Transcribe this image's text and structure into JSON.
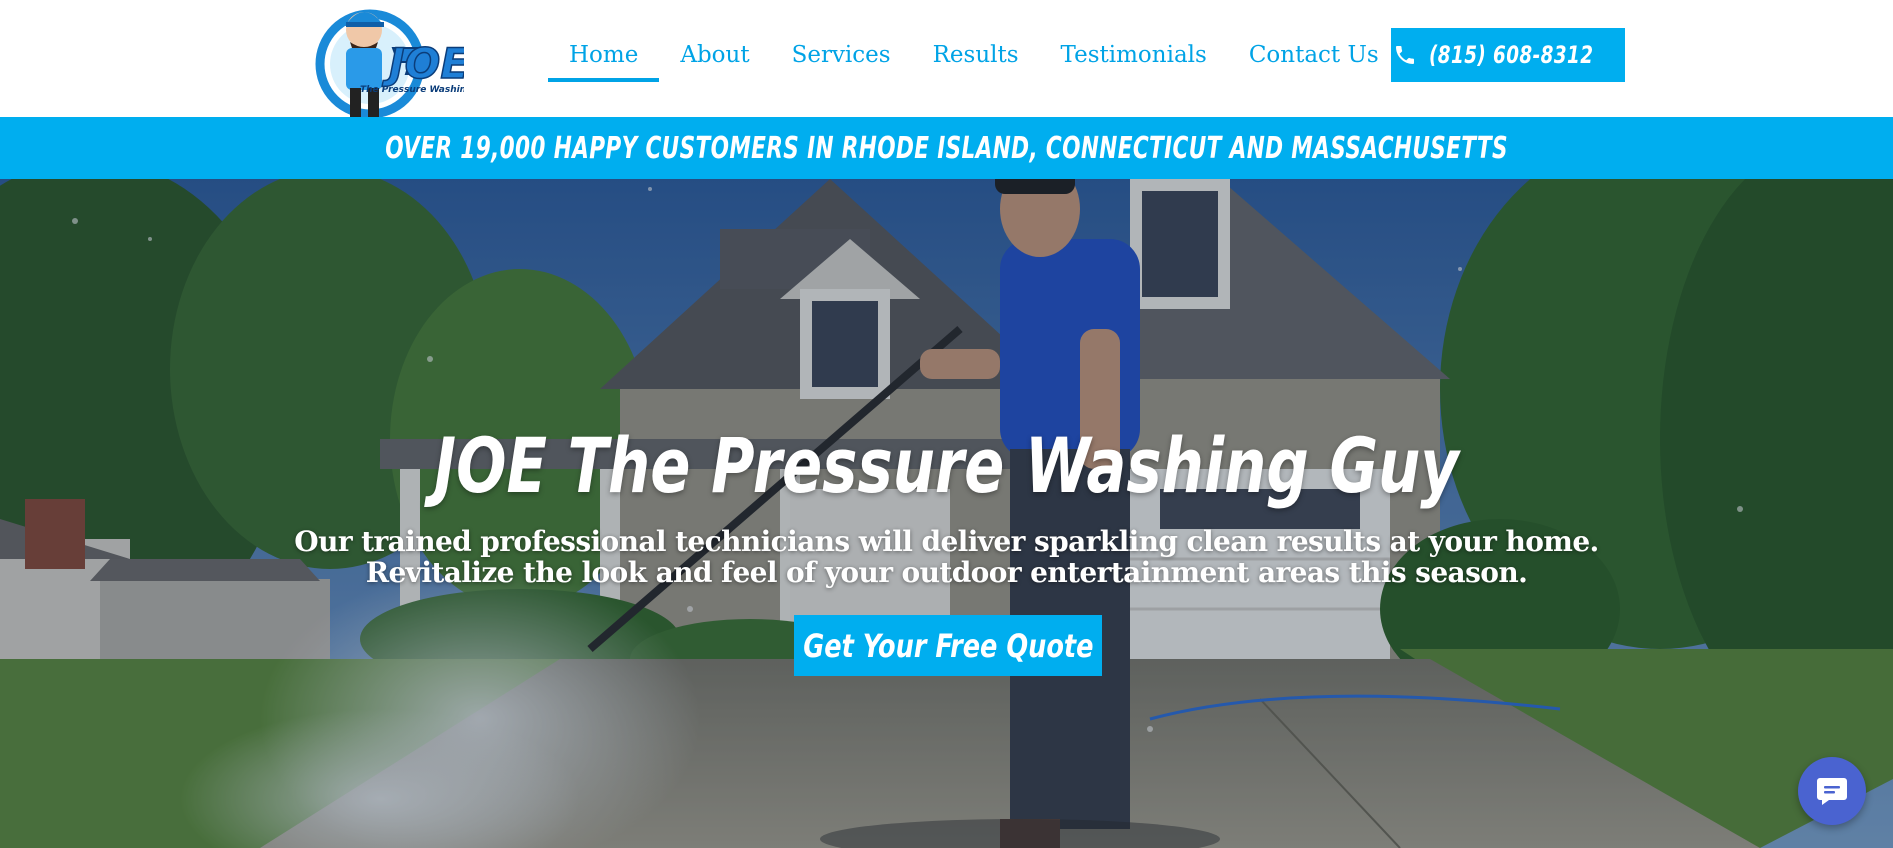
{
  "logo": {
    "name": "JOE",
    "tagline": "The Pressure Washing Guy",
    "alt": "JOE The Pressure Washing Guy logo"
  },
  "nav": {
    "items": [
      {
        "label": "Home",
        "active": true
      },
      {
        "label": "About",
        "active": false
      },
      {
        "label": "Services",
        "active": false
      },
      {
        "label": "Results",
        "active": false
      },
      {
        "label": "Testimonials",
        "active": false
      },
      {
        "label": "Contact Us",
        "active": false
      }
    ]
  },
  "header": {
    "phone": "(815) 608-8312",
    "phone_icon": "phone-icon"
  },
  "banner": {
    "text": "OVER 19,000 HAPPY CUSTOMERS IN RHODE ISLAND, CONNECTICUT AND MASSACHUSETTS"
  },
  "hero": {
    "title": "JOE The Pressure Washing Guy",
    "subtitle": "Our trained professional technicians will deliver sparkling clean results at your home. Revitalize the look and feel of your outdoor entertainment areas this season.",
    "cta": "Get Your Free Quote"
  },
  "chat": {
    "icon": "chat-icon"
  },
  "colors": {
    "accent": "#00aeef",
    "nav_text": "#00a3e6",
    "chat": "#4a63d0"
  }
}
